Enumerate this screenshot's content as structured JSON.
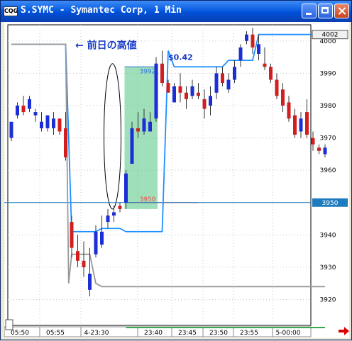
{
  "window": {
    "title": "S.SYMC - Symantec Corp, 1 Min",
    "icon": "chart-app-icon",
    "icon_text": "CQG",
    "buttons": [
      "minimize",
      "maximize",
      "close"
    ]
  },
  "annotations": {
    "prev_high_label": "← 前日の高値",
    "gain_label": "$0.42",
    "top_level_label": "3992",
    "bottom_level_label": "3950"
  },
  "colors": {
    "up_candle": "#1c2fd6",
    "down_candle": "#d11f1f",
    "line_blue": "#1e90ff",
    "line_gray": "#999999",
    "highlight_fill": "#5fc98a",
    "current_price_line": "#1f7bbf",
    "price_marker_bg": "#1f7bbf",
    "label_blue": "#1a3cc8",
    "next_arrow": "#e00000"
  },
  "chart_data": {
    "type": "candlestick",
    "title": "S.SYMC - Symantec Corp, 1 Min",
    "ylim": [
      3912,
      4005
    ],
    "yticks": [
      3920,
      3930,
      3940,
      3950,
      3960,
      3970,
      3980,
      3990,
      4000
    ],
    "y_markers": [
      {
        "value": 4002,
        "label": "4002",
        "style": "boxed"
      },
      {
        "value": 3950,
        "label": "3950",
        "style": "current"
      }
    ],
    "xticks": [
      "05:50",
      "05:55",
      "4-23:30",
      "23:40",
      "23:45",
      "23:50",
      "23:55",
      "5-00:00"
    ],
    "candles": [
      [
        0,
        3970,
        3975,
        3969,
        3975
      ],
      [
        1,
        3977,
        3981,
        3976,
        3980
      ],
      [
        2,
        3980,
        3983,
        3977,
        3978
      ],
      [
        3,
        3979,
        3983,
        3978,
        3982
      ],
      [
        4,
        3977,
        3979,
        3975,
        3978
      ],
      [
        5,
        3973,
        3978,
        3972,
        3975
      ],
      [
        6,
        3973,
        3977,
        3972,
        3977
      ],
      [
        7,
        3973,
        3978,
        3971,
        3976
      ],
      [
        8,
        3976,
        3976,
        3971,
        3972
      ],
      [
        9,
        3973,
        3978,
        3963,
        3964
      ],
      [
        10,
        3944,
        3946,
        3933,
        3936
      ],
      [
        11,
        3935,
        3940,
        3930,
        3932
      ],
      [
        12,
        3932,
        3938,
        3927,
        3930
      ],
      [
        13,
        3923,
        3936,
        3921,
        3928
      ],
      [
        14,
        3934,
        3943,
        3933,
        3941
      ],
      [
        15,
        3937,
        3946,
        3936,
        3941
      ],
      [
        16,
        3944,
        3948,
        3942,
        3946
      ],
      [
        17,
        3946,
        3949,
        3944,
        3947
      ],
      [
        18,
        3949,
        3950,
        3947,
        3948
      ],
      [
        19,
        3950,
        3960,
        3948,
        3959
      ],
      [
        20,
        3962,
        3975,
        3962,
        3973
      ],
      [
        21,
        3973,
        3978,
        3970,
        3972
      ],
      [
        22,
        3972,
        3979,
        3971,
        3976
      ],
      [
        23,
        3972,
        3978,
        3972,
        3975
      ],
      [
        24,
        3976,
        3995,
        3975,
        3993
      ],
      [
        25,
        3993,
        3997,
        3986,
        3987
      ],
      [
        26,
        3987,
        3988,
        3984,
        3984
      ],
      [
        27,
        3981,
        3987,
        3981,
        3986
      ],
      [
        28,
        3986,
        3990,
        3981,
        3984
      ],
      [
        29,
        3984,
        3986,
        3979,
        3982
      ],
      [
        30,
        3983,
        3988,
        3982,
        3986
      ],
      [
        31,
        3984,
        3987,
        3982,
        3983
      ],
      [
        32,
        3982,
        3985,
        3976,
        3979
      ],
      [
        33,
        3980,
        3986,
        3977,
        3983
      ],
      [
        34,
        3984,
        3992,
        3982,
        3990
      ],
      [
        35,
        3990,
        3992,
        3986,
        3987
      ],
      [
        36,
        3985,
        3990,
        3984,
        3988
      ],
      [
        37,
        3988,
        3994,
        3987,
        3992
      ],
      [
        38,
        3994,
        3999,
        3992,
        3998
      ],
      [
        39,
        4000,
        4003,
        3999,
        4002
      ],
      [
        40,
        4002,
        4004,
        3996,
        3998
      ],
      [
        41,
        3996,
        4002,
        3994,
        3999
      ],
      [
        42,
        3993,
        3998,
        3991,
        3992
      ],
      [
        43,
        3992,
        3993,
        3987,
        3988
      ],
      [
        44,
        3988,
        3990,
        3982,
        3983
      ],
      [
        45,
        3985,
        3987,
        3978,
        3980
      ],
      [
        46,
        3981,
        3983,
        3975,
        3976
      ],
      [
        47,
        3977,
        3979,
        3970,
        3971
      ],
      [
        48,
        3972,
        3978,
        3970,
        3976
      ],
      [
        49,
        3978,
        3982,
        3970,
        3971
      ],
      [
        50,
        3970,
        3972,
        3966,
        3968
      ],
      [
        51,
        3967,
        3968,
        3965,
        3966
      ],
      [
        52,
        3965,
        3968,
        3964,
        3967
      ]
    ],
    "series": [
      {
        "color": "blue",
        "points": [
          [
            0,
            3999
          ],
          [
            9,
            3999
          ],
          [
            10,
            3941
          ],
          [
            11,
            3941
          ],
          [
            14,
            3941
          ],
          [
            15,
            3942
          ],
          [
            16,
            3942
          ],
          [
            18,
            3942
          ],
          [
            19,
            3941
          ],
          [
            25,
            3941
          ],
          [
            26,
            3997
          ],
          [
            27,
            3992
          ],
          [
            35,
            3992
          ],
          [
            36,
            3994
          ],
          [
            40,
            3994
          ],
          [
            41,
            4002
          ],
          [
            52,
            4002
          ]
        ]
      },
      {
        "color": "gray",
        "points": [
          [
            0,
            3999
          ],
          [
            9,
            3999
          ],
          [
            9.5,
            3925
          ],
          [
            10,
            3934
          ],
          [
            13,
            3934
          ],
          [
            14,
            3925
          ],
          [
            15,
            3924
          ],
          [
            52,
            3924
          ]
        ]
      }
    ],
    "highlight_region": {
      "x_start": 19,
      "x_end": 24,
      "y_low": 3948,
      "y_high": 3992
    },
    "ellipse": {
      "x_start": 17,
      "x_end": 22,
      "y_low": 3948,
      "y_high": 3993
    },
    "level_lines": [
      {
        "value": 3950,
        "color": "red"
      },
      {
        "value": 3992,
        "color": "blue"
      }
    ],
    "current_price": 3950,
    "grid": true
  }
}
